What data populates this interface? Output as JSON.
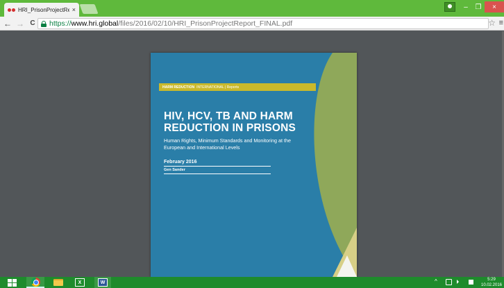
{
  "browser": {
    "tab": {
      "title": "HRI_PrisonProjectReport_",
      "close": "×"
    },
    "window_controls": {
      "minimize": "–",
      "maximize": "❐",
      "close": "×"
    },
    "url": {
      "scheme": "https://",
      "host": "www.hri.global",
      "path": "/files/2016/02/10/HRI_PrisonProjectReport_FINAL.pdf"
    },
    "icons": {
      "back": "←",
      "forward": "→",
      "reload": "C",
      "star": "☆",
      "menu": "≡"
    }
  },
  "pdf": {
    "series_bold": "HARM REDUCTION",
    "series_rest": "INTERNATIONAL  |  Reports",
    "title": "HIV, HCV, TB AND HARM REDUCTION IN PRISONS",
    "subtitle": "Human Rights, Minimum Standards and Monitoring at the European and International Levels",
    "date": "February 2016",
    "author": "Gen Sander",
    "colors": {
      "background": "#2a7ea8",
      "arc": "#8fa85a",
      "bar": "#c9b92b"
    }
  },
  "taskbar": {
    "excel_label": "X",
    "word_label": "W",
    "tray_chevron": "^",
    "time": "5:29",
    "date": "10.02.2016"
  }
}
